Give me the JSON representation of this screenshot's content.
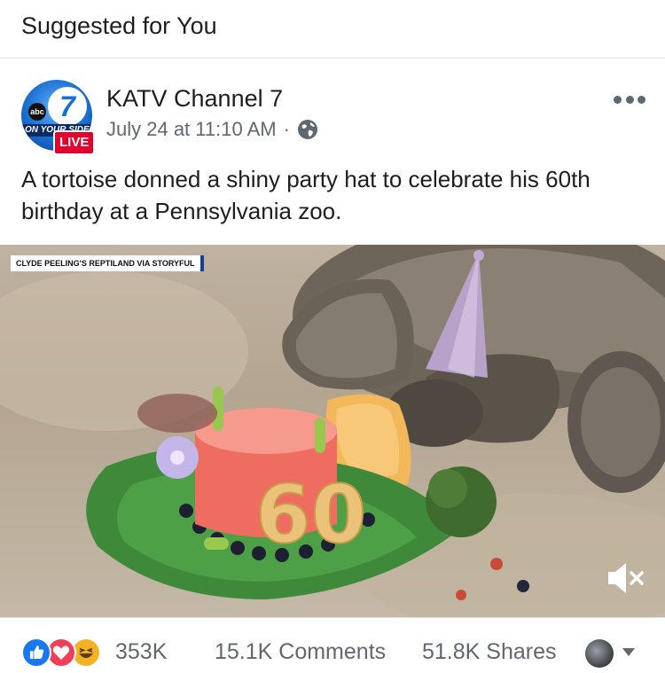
{
  "section": {
    "title": "Suggested for You"
  },
  "post": {
    "page_name": "KATV Channel 7",
    "timestamp": "July 24 at 11:10 AM",
    "separator": "·",
    "privacy_icon": "globe-icon",
    "more_icon": "more-options-icon",
    "avatar": {
      "abc_text": "abc",
      "number": "7",
      "tagline": "ON YOUR SIDE",
      "live_label": "LIVE"
    },
    "text": "A tortoise donned a shiny party hat to celebrate his 60th birthday at a Pennsylvania zoo.",
    "video": {
      "credit": "CLYDE PEELING'S REPTILAND VIA STORYFUL",
      "cake_number": "60",
      "mute_icon": "speaker-muted-icon"
    }
  },
  "footer": {
    "reactions": [
      "like-icon",
      "love-icon",
      "haha-icon"
    ],
    "reaction_count": "353K",
    "comments": "15.1K Comments",
    "shares": "51.8K Shares"
  },
  "colors": {
    "facebook_blue": "#1877f2",
    "love_red": "#f33e58",
    "haha_yellow": "#f7b125",
    "live_red": "#e4002b",
    "secondary_text": "#606770"
  }
}
